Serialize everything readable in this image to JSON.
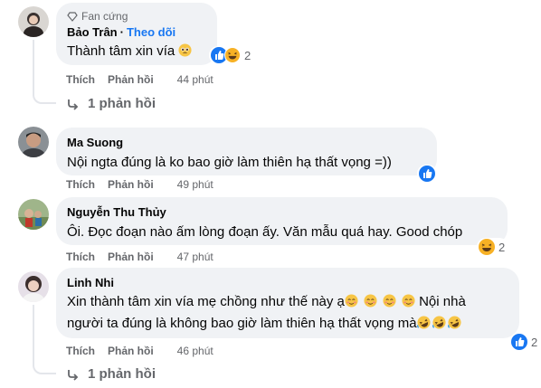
{
  "colors": {
    "bubble": "#f0f2f5",
    "meta_text": "#65676b",
    "follow_blue": "#1877f2",
    "like_blue": "#1877f2",
    "haha_yellow": "#f7b125"
  },
  "comments": [
    {
      "badge": "Fan cứng",
      "author": "Bảo Trân",
      "follow_label": "Theo dõi",
      "text": "Thành tâm xin vía",
      "reaction_icons": [
        "like-icon",
        "haha-icon"
      ],
      "reaction_count": "2",
      "like_label": "Thích",
      "reply_label": "Phản hồi",
      "time": "44 phút",
      "replies_label": "1 phản hồi"
    },
    {
      "author": "Ma Suong",
      "text": "Nội ngta đúng là ko bao giờ làm thiên hạ thất vọng =))",
      "reaction_icons": [
        "like-icon"
      ],
      "like_label": "Thích",
      "reply_label": "Phản hồi",
      "time": "49 phút"
    },
    {
      "author": "Nguyễn Thu Thủy",
      "text": "Ôi. Đọc đoạn nào ấm lòng đoạn ấy. Văn mẫu quá hay. Good chóp",
      "reaction_icons": [
        "haha-icon"
      ],
      "reaction_count": "2",
      "like_label": "Thích",
      "reply_label": "Phản hồi",
      "time": "47 phút"
    },
    {
      "author": "Linh Nhi",
      "text_line1": "Xin thành tâm xin vía mẹ chồng như thế này ạ",
      "text_line2_a": "Nội nhà",
      "text_line2": "người ta đúng là không bao giờ làm thiên hạ thất vọng mà",
      "reaction_icons": [
        "like-icon"
      ],
      "reaction_count": "2",
      "like_label": "Thích",
      "reply_label": "Phản hồi",
      "time": "46 phút",
      "replies_label": "1 phản hồi"
    }
  ]
}
